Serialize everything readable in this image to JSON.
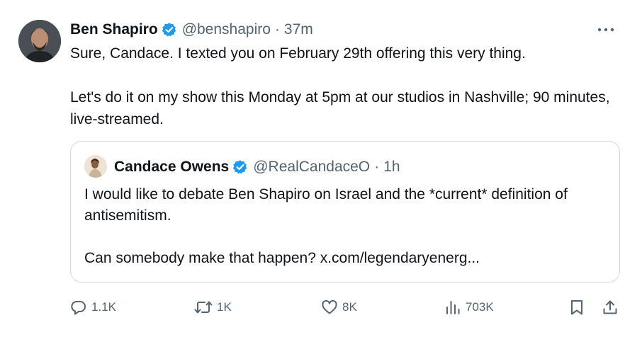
{
  "post": {
    "author_name": "Ben Shapiro",
    "handle": "@benshapiro",
    "separator": "·",
    "time": "37m",
    "paragraphs": [
      "Sure, Candace. I texted you on February 29th offering this very thing.",
      "Let's do it on my show this Monday at 5pm at our studios in Nashville; 90 minutes, live-streamed."
    ]
  },
  "quote": {
    "author_name": "Candace Owens",
    "handle": "@RealCandaceO",
    "separator": "·",
    "time": "1h",
    "paragraphs": [
      "I would like to debate Ben Shapiro on Israel and the *current* definition of antisemitism.",
      "Can somebody make that happen? x.com/legendaryenerg..."
    ]
  },
  "actions": {
    "replies": "1.1K",
    "reposts": "1K",
    "likes": "8K",
    "views": "703K"
  },
  "icons": {
    "verified": "verified-badge-icon",
    "more": "more-options-icon",
    "reply": "reply-icon",
    "repost": "repost-icon",
    "like": "heart-icon",
    "views": "views-chart-icon",
    "bookmark": "bookmark-icon",
    "share": "share-icon"
  },
  "colors": {
    "text": "#0f1419",
    "secondary": "#536471",
    "verified": "#1d9bf0",
    "border": "#cfd9de"
  }
}
